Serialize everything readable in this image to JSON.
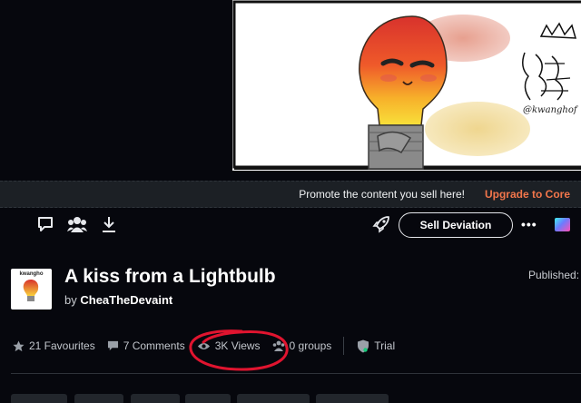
{
  "promo": {
    "text": "Promote the content you sell here!",
    "link": "Upgrade to Core"
  },
  "actions": {
    "comment_icon": "comment-icon",
    "watch_icon": "users-icon",
    "download_icon": "download-icon",
    "boost_icon": "rocket-icon",
    "sell_label": "Sell Deviation",
    "more_label": "•••"
  },
  "artwork": {
    "signature": "@kwanghof"
  },
  "deviation": {
    "avatar_text": "kwangho",
    "title": "A kiss from a Lightbulb",
    "by_prefix": "by",
    "author": "CheaTheDevaint",
    "published_label": "Published:"
  },
  "stats": {
    "favourites": "21 Favourites",
    "comments": "7 Comments",
    "views": "3K Views",
    "groups": "0 groups",
    "trial": "Trial"
  },
  "colors": {
    "accent": "#f2764b",
    "background": "#06070d",
    "annotation": "#e0142f"
  }
}
